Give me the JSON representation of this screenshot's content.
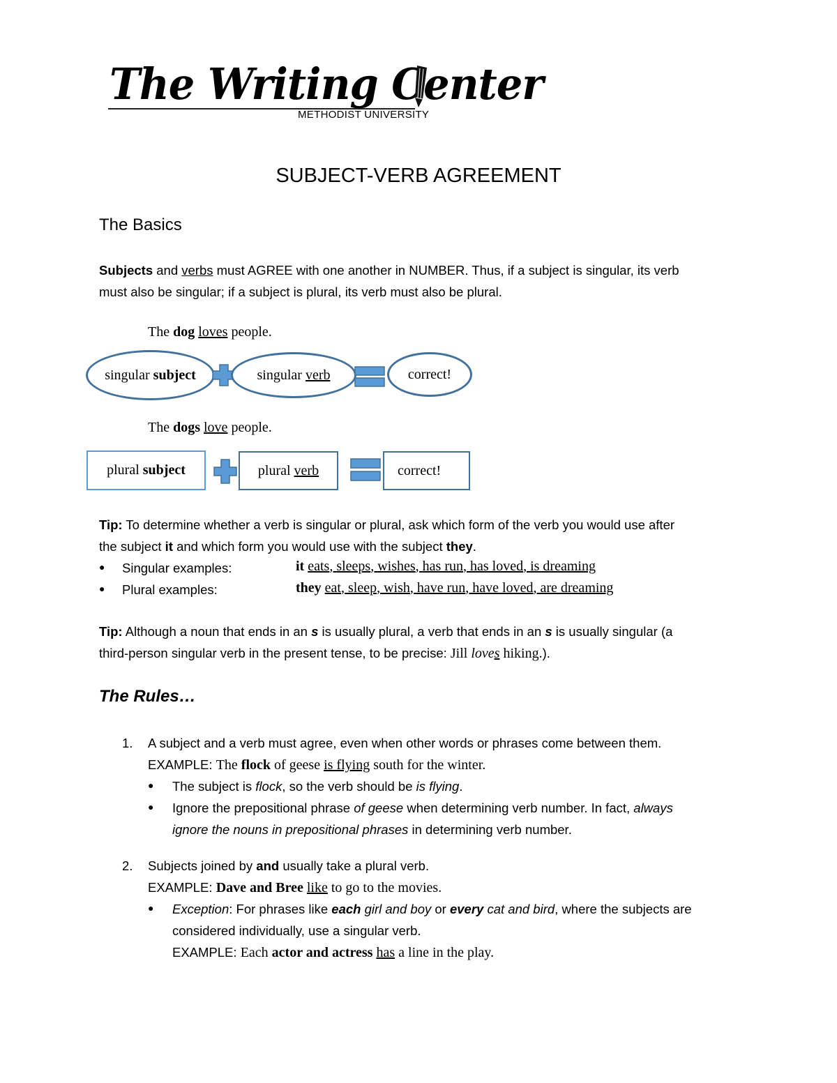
{
  "logo": {
    "name": "The Writing Center",
    "subtitle": "METHODIST UNIVERSITY"
  },
  "title": "SUBJECT-VERB AGREEMENT",
  "basics": {
    "heading": "The Basics",
    "intro": {
      "subjects": "Subjects",
      "and": " and ",
      "verbs": "verbs",
      "rest1": " must AGREE with one another in NUMBER.  Thus, if a subject is singular, its verb",
      "line2": "must also be singular; if a subject is plural, its verb must also be plural."
    },
    "example1": {
      "the": "The ",
      "subject": "dog",
      "sp": " ",
      "verb": "loves",
      "rest": " people."
    },
    "diagram1": {
      "shape": "oval",
      "subject_prefix": "singular ",
      "subject_word": "subject",
      "verb_prefix": "singular ",
      "verb_word": "verb",
      "result": "correct!",
      "operator_plus": "plus-icon",
      "operator_equals": "equals-icon"
    },
    "example2": {
      "the": "The ",
      "subject": "dogs",
      "sp": " ",
      "verb": "love",
      "rest": " people."
    },
    "diagram2": {
      "shape": "box",
      "subject_prefix": "plural ",
      "subject_word": "subject",
      "verb_prefix": "plural ",
      "verb_word": "verb",
      "result": "correct!",
      "operator_plus": "plus-icon",
      "operator_equals": "equals-icon"
    },
    "colors": {
      "shape_fill": "#5b9bd5",
      "shape_stroke": "#41719c"
    }
  },
  "tip1": {
    "label": "Tip:",
    "text1": " To determine whether a verb is singular or plural, ask which form of the verb you would use after",
    "text2a": "the subject ",
    "it": "it",
    "text2b": " and which form you would use with the subject ",
    "they": "they",
    "text2c": ".",
    "bullets": [
      {
        "label": "Singular examples:",
        "pronoun": "it",
        "forms": [
          "eats",
          "sleeps",
          "wishes",
          "has run",
          "has loved",
          "is dreaming"
        ]
      },
      {
        "label": "Plural examples:",
        "pronoun": "they",
        "forms": [
          "eat",
          "sleep",
          "wish",
          "have run",
          "have loved",
          "are dreaming"
        ]
      }
    ]
  },
  "tip2": {
    "label": "Tip:",
    "a": " Although a noun that ends in an ",
    "s1": "s",
    "b": " is usually plural, a verb that ends in an ",
    "s2": "s",
    "c": " is usually singular (a",
    "line2": "third-person singular verb in the present tense, to be precise: ",
    "ex_name": "Jill ",
    "ex_verb_stem": "love",
    "ex_verb_s": "s",
    "ex_rest": " hiking.",
    "close": ")."
  },
  "rules": {
    "heading": "The Rules…",
    "items": [
      {
        "num": "1.",
        "text": "A subject and a verb must agree, even when other words or phrases come between them.",
        "example": {
          "label": "EXAMPLE: ",
          "a": "The ",
          "subject": "flock",
          "b": " of geese ",
          "verb": "is flying",
          "c": " south for the winter."
        },
        "bullets": [
          {
            "a": "The subject is ",
            "i1": "flock",
            "b": ", so the verb should be ",
            "i2": "is flying",
            "c": "."
          },
          {
            "a": "Ignore the prepositional phrase ",
            "i1": "of geese",
            "b": " when determining verb number. In fact, ",
            "i2": "always",
            "line2_i": "ignore the nouns in prepositional phrases",
            "line2_rest": " in determining verb number."
          }
        ]
      },
      {
        "num": "2.",
        "text_a": "Subjects joined by ",
        "text_b": "and",
        "text_c": " usually take a plural verb.",
        "example": {
          "label": "EXAMPLE: ",
          "subject": "Dave and Bree",
          "sp": " ",
          "verb": "like",
          "rest": " to go to the movies."
        },
        "bullets": [
          {
            "i_exception": "Exception",
            "a": ": For phrases like ",
            "bi_each": "each",
            "i_girl": " girl and boy",
            "or": " or ",
            "bi_every": "every",
            "i_cat": " cat and bird",
            "b": ", where the subjects are",
            "line2": "considered individually, use a singular verb.",
            "example": {
              "label": "EXAMPLE: ",
              "a": "Each ",
              "subject": "actor and actress",
              "sp": " ",
              "verb": "has",
              "rest": " a line in the play."
            }
          }
        ]
      }
    ]
  }
}
